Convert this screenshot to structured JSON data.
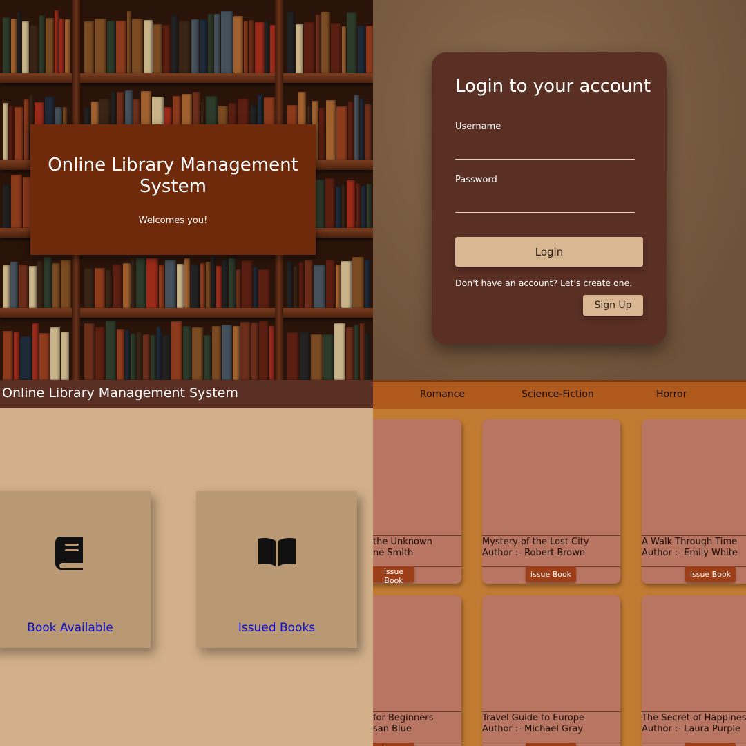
{
  "landing": {
    "title": "Online Library Management System",
    "subtitle": "Welcomes you!"
  },
  "login": {
    "heading": "Login to your account",
    "username_label": "Username",
    "username_value": "",
    "password_label": "Password",
    "password_value": "",
    "login_button": "Login",
    "signup_prompt": "Don't have an account? Let's create one.",
    "signup_button": "Sign Up"
  },
  "dashboard": {
    "header_title": "Online Library Management System",
    "cards": [
      {
        "label": "Book Available",
        "icon": "book-icon"
      },
      {
        "label": "Issued Books",
        "icon": "open-book-icon"
      }
    ]
  },
  "catalog": {
    "categories": [
      "Romance",
      "Science-Fiction",
      "Horror"
    ],
    "issue_label": "issue Book",
    "books": [
      {
        "title": "the Unknown",
        "author": "ne Smith"
      },
      {
        "title": "Mystery of the Lost City",
        "author": "Author :- Robert Brown"
      },
      {
        "title": "A Walk Through Time",
        "author": "Author :- Emily White"
      },
      {
        "title": "for Beginners",
        "author": "san Blue"
      },
      {
        "title": "Travel Guide to Europe",
        "author": "Author :- Michael Gray"
      },
      {
        "title": "The Secret of Happiness",
        "author": "Author :- Laura Purple"
      }
    ]
  },
  "colors": {
    "brown_dark": "#5a2f24",
    "hero_bg": "#6f2a0c",
    "button_tan": "#d8b792",
    "dashboard_bg": "#d3b08a",
    "card_tan": "#b89974",
    "link_blue": "#0b0bd6",
    "catalog_bg": "#c07a32",
    "book_card": "#b87562",
    "issue_button": "#9c3e17"
  }
}
